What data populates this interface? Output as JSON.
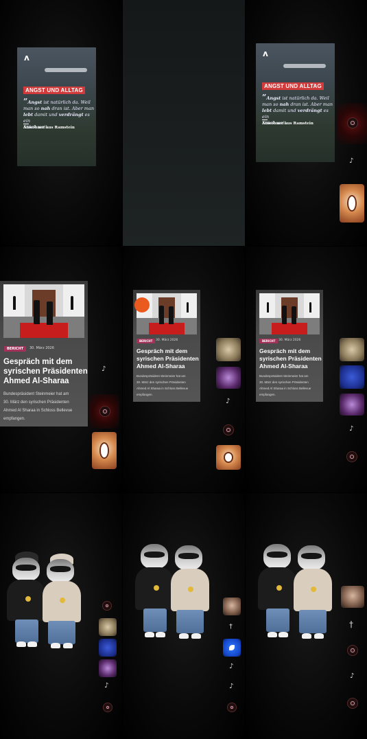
{
  "quote_card": {
    "tag": "ANGST UND ALLTAG",
    "quote_mark": "”",
    "quote_line1_b1": "Angst",
    "quote_line1_rest": " ist natürlich da. Weil",
    "quote_line2_a": "man so ",
    "quote_line2_b": "nah",
    "quote_line2_c": " dran ist. Aber man",
    "quote_line3_b1": "lebt",
    "quote_line3_a": " damit und ",
    "quote_line3_b2": "verdrängt",
    "quote_line3_c": " es ein",
    "quote_line4": "Stück weit.",
    "author": "Anwohner aus Ramstein",
    "logo_glyph": "ʌ"
  },
  "news_card": {
    "badge": "BERICHT",
    "date": "30. März 2026",
    "title_lines": [
      "Gespräch mit dem",
      "syrischen Präsidenten",
      "Ahmed Al-Sharaa"
    ],
    "body_big_lines": [
      "Bundespräsident Steinmeier hat am",
      "30. März den syrischen Präsidenten",
      "Ahmed Al Sharaa in Schloss Bellevue",
      "empfangen."
    ],
    "body_small_lines": [
      "Bundespräsident Steinmeier hat am",
      "30. März den syrischen Präsidenten",
      "Ahmed Al Sharaa in Schloss Bellevue",
      "empfangen."
    ]
  },
  "icons": {
    "tiktok_glyph": "♪",
    "person_glyph": "☥",
    "stick_glyph": "†"
  },
  "colors": {
    "tag_red": "#d23b3b",
    "badge_magenta": "#a3325a",
    "background": "#000000"
  }
}
